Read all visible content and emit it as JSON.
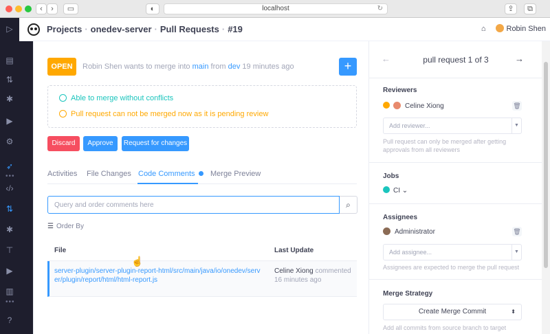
{
  "browser": {
    "url": "localhost",
    "back_icon": "chevron-left",
    "forward_icon": "chevron-right"
  },
  "header": {
    "breadcrumbs": [
      "Projects",
      "onedev-server",
      "Pull Requests",
      "#19"
    ],
    "user_name": "Robin Shen"
  },
  "pr": {
    "status": "OPEN",
    "author": "Robin Shen",
    "action": "wants to merge into",
    "target_branch": "main",
    "from_word": "from",
    "source_branch": "dev",
    "time": "19 minutes ago",
    "add_label": "+",
    "merge_ok": "Able to merge without conflicts",
    "merge_pending": "Pull request can not be merged now as it is pending review",
    "buttons": {
      "discard": "Discard",
      "approve": "Approve",
      "request_changes": "Request for changes"
    }
  },
  "tabs": [
    "Activities",
    "File Changes",
    "Code Comments",
    "Merge Preview"
  ],
  "active_tab": "Code Comments",
  "comments": {
    "query_placeholder": "Query and order comments here",
    "order_by": "Order By",
    "columns": {
      "file": "File",
      "last_update": "Last Update"
    },
    "rows": [
      {
        "file": "server-plugin/server-plugin-report-html/src/main/java/io/onedev/server/plugin/report/html/html-report.js",
        "user": "Celine Xiong",
        "action": "commented",
        "time": "16 minutes ago"
      }
    ]
  },
  "sidebar": {
    "pager": "pull request 1 of 3",
    "reviewers": {
      "title": "Reviewers",
      "items": [
        "Celine Xiong"
      ],
      "add_placeholder": "Add reviewer...",
      "hint": "Pull request can only be merged after getting approvals from all reviewers"
    },
    "jobs": {
      "title": "Jobs",
      "items": [
        "CI"
      ]
    },
    "assignees": {
      "title": "Assignees",
      "items": [
        "Administrator"
      ],
      "add_placeholder": "Add assignee...",
      "hint": "Assignees are expected to merge the pull request"
    },
    "merge_strategy": {
      "title": "Merge Strategy",
      "value": "Create Merge Commit",
      "hint": "Add all commits from source branch to target"
    }
  },
  "colors": {
    "primary": "#3699ff",
    "warning": "#ffa800",
    "success": "#1bc5bd",
    "danger": "#f64e60",
    "rail": "#1e1e2d"
  }
}
